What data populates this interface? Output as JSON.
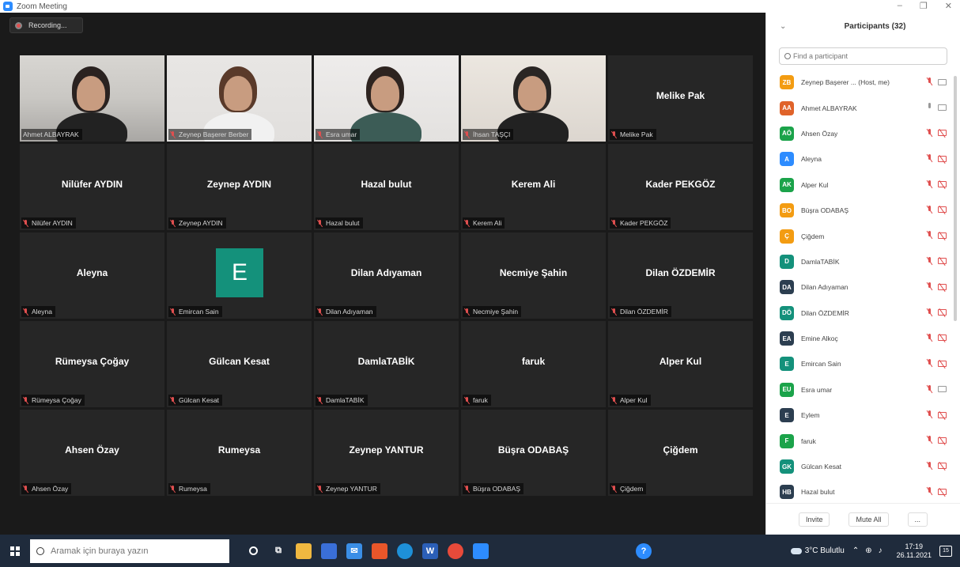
{
  "window": {
    "title": "Zoom Meeting"
  },
  "recording": {
    "label": "Recording..."
  },
  "tiles": [
    {
      "big": "",
      "label": "Ahmet ALBAYRAK",
      "video": "v1",
      "muted": false,
      "active": true
    },
    {
      "big": "",
      "label": "Zeynep Başerer Berber",
      "video": "v2",
      "muted": true
    },
    {
      "big": "",
      "label": "Esra umar",
      "video": "v3",
      "muted": true
    },
    {
      "big": "",
      "label": "İhsan TAŞÇI",
      "video": "v4",
      "muted": true
    },
    {
      "big": "Melike Pak",
      "label": "Melike Pak",
      "muted": true
    },
    {
      "big": "Nilüfer AYDIN",
      "label": "Nilüfer AYDIN",
      "muted": true
    },
    {
      "big": "Zeynep AYDIN",
      "label": "Zeynep AYDIN",
      "muted": true
    },
    {
      "big": "Hazal bulut",
      "label": "Hazal bulut",
      "muted": true
    },
    {
      "big": "Kerem Ali",
      "label": "Kerem Ali",
      "muted": true
    },
    {
      "big": "Kader PEKGÖZ",
      "label": "Kader PEKGÖZ",
      "muted": true
    },
    {
      "big": "Aleyna",
      "label": "Aleyna",
      "muted": true
    },
    {
      "big": "",
      "label": "Emircan Sain",
      "avatar": "E",
      "muted": true
    },
    {
      "big": "Dilan Adıyaman",
      "label": "Dilan Adıyaman",
      "muted": true
    },
    {
      "big": "Necmiye Şahin",
      "label": "Necmiye Şahin",
      "muted": true
    },
    {
      "big": "Dilan ÖZDEMİR",
      "label": "Dilan ÖZDEMİR",
      "muted": true
    },
    {
      "big": "Rümeysa Çoğay",
      "label": "Rümeysa Çoğay",
      "muted": true
    },
    {
      "big": "Gülcan Kesat",
      "label": "Gülcan Kesat",
      "muted": true
    },
    {
      "big": "DamlaTABİK",
      "label": "DamlaTABİK",
      "muted": true
    },
    {
      "big": "faruk",
      "label": "faruk",
      "muted": true
    },
    {
      "big": "Alper Kul",
      "label": "Alper Kul",
      "muted": true
    },
    {
      "big": "Ahsen Özay",
      "label": "Ahsen Özay",
      "muted": true
    },
    {
      "big": "Rumeysa",
      "label": "Rumeysa",
      "muted": true
    },
    {
      "big": "Zeynep YANTUR",
      "label": "Zeynep YANTUR",
      "muted": true
    },
    {
      "big": "Büşra ODABAŞ",
      "label": "Büşra ODABAŞ",
      "muted": true
    },
    {
      "big": "Çiğdem",
      "label": "Çiğdem",
      "muted": true
    }
  ],
  "participants": {
    "title": "Participants (32)",
    "search_placeholder": "Find a participant",
    "items": [
      {
        "initials": "ZB",
        "name": "Zeynep Başerer ... (Host, me)",
        "color": "#f39c12",
        "mic": "off",
        "cam": "on"
      },
      {
        "initials": "AA",
        "name": "Ahmet ALBAYRAK",
        "color": "#e0632a",
        "mic": "on",
        "cam": "on"
      },
      {
        "initials": "AÖ",
        "name": "Ahsen Özay",
        "color": "#1ba34a",
        "mic": "off",
        "cam": "off"
      },
      {
        "initials": "A",
        "name": "Aleyna",
        "color": "#2d8cff",
        "mic": "off",
        "cam": "off"
      },
      {
        "initials": "AK",
        "name": "Alper Kul",
        "color": "#1ba34a",
        "mic": "off",
        "cam": "off"
      },
      {
        "initials": "BO",
        "name": "Büşra ODABAŞ",
        "color": "#f39c12",
        "mic": "off",
        "cam": "off"
      },
      {
        "initials": "Ç",
        "name": "Çiğdem",
        "color": "#f39c12",
        "mic": "off",
        "cam": "off"
      },
      {
        "initials": "D",
        "name": "DamlaTABİK",
        "color": "#14917b",
        "mic": "off",
        "cam": "off"
      },
      {
        "initials": "DA",
        "name": "Dilan Adıyaman",
        "color": "#2c3e50",
        "mic": "off",
        "cam": "off"
      },
      {
        "initials": "DÖ",
        "name": "Dilan ÖZDEMİR",
        "color": "#14917b",
        "mic": "off",
        "cam": "off"
      },
      {
        "initials": "EA",
        "name": "Emine Alkoç",
        "color": "#2c3e50",
        "mic": "off",
        "cam": "off"
      },
      {
        "initials": "E",
        "name": "Emircan Sain",
        "color": "#14917b",
        "mic": "off",
        "cam": "off"
      },
      {
        "initials": "EU",
        "name": "Esra umar",
        "color": "#1ba34a",
        "mic": "off",
        "cam": "on"
      },
      {
        "initials": "E",
        "name": "Eylem",
        "color": "#2c3e50",
        "mic": "off",
        "cam": "off"
      },
      {
        "initials": "F",
        "name": "faruk",
        "color": "#1ba34a",
        "mic": "off",
        "cam": "off"
      },
      {
        "initials": "GK",
        "name": "Gülcan Kesat",
        "color": "#14917b",
        "mic": "off",
        "cam": "off"
      },
      {
        "initials": "HB",
        "name": "Hazal bulut",
        "color": "#2c3e50",
        "mic": "off",
        "cam": "off"
      }
    ],
    "invite_label": "Invite",
    "mute_all_label": "Mute All",
    "more_label": "..."
  },
  "taskbar": {
    "search_placeholder": "Aramak için buraya yazın",
    "weather": "3°C Bulutlu",
    "time": "17:19",
    "date": "26.11.2021",
    "notification_count": "15"
  }
}
